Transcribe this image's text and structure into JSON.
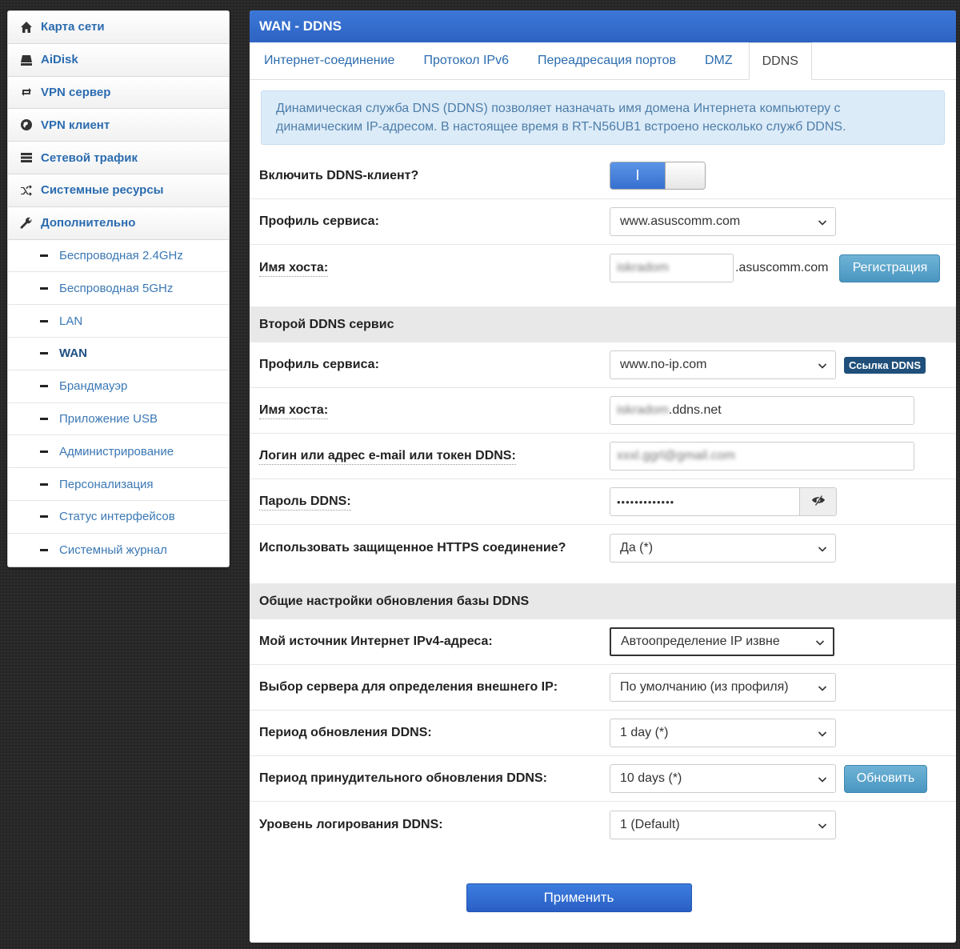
{
  "sidebar": {
    "items": [
      {
        "label": "Карта сети",
        "icon": "home-icon"
      },
      {
        "label": "AiDisk",
        "icon": "drive-icon"
      },
      {
        "label": "VPN сервер",
        "icon": "retweet-icon"
      },
      {
        "label": "VPN клиент",
        "icon": "globe-icon"
      },
      {
        "label": "Сетевой трафик",
        "icon": "tasks-icon"
      },
      {
        "label": "Системные ресурсы",
        "icon": "random-icon"
      },
      {
        "label": "Дополнительно",
        "icon": "wrench-icon"
      }
    ],
    "subitems": [
      "Беспроводная 2.4GHz",
      "Беспроводная 5GHz",
      "LAN",
      "WAN",
      "Брандмауэр",
      "Приложение USB",
      "Администрирование",
      "Персонализация",
      "Статус интерфейсов",
      "Системный журнал"
    ],
    "active_subitem": "WAN"
  },
  "panel": {
    "title": "WAN - DDNS",
    "tabs": [
      "Интернет-соединение",
      "Протокол IPv6",
      "Переадресация портов",
      "DMZ",
      "DDNS"
    ],
    "active_tab": "DDNS",
    "info": "Динамическая служба DNS (DDNS) позволяет назначать имя домена Интернета компьютеру с динамическим IP-адресом. В настоящее время в RT-N56UB1 встроено несколько служб DDNS."
  },
  "ddns": {
    "enable_label": "Включить DDNS-клиент?",
    "enable_on_text": "I",
    "profile_label": "Профиль сервиса:",
    "profile_value": "www.asuscomm.com",
    "host_label": "Имя хоста:",
    "host_value": "iskradom",
    "host_suffix": ".asuscomm.com",
    "register_button": "Регистрация"
  },
  "second": {
    "title": "Второй DDNS сервис",
    "profile_label": "Профиль сервиса:",
    "profile_value": "www.no-ip.com",
    "link_badge": "Ссылка DDNS",
    "host_label": "Имя хоста:",
    "host_prefix": "iskradom",
    "host_suffix": ".ddns.net",
    "login_label": "Логин или адрес e-mail или токен DDNS:",
    "login_value": "xxxl.ggrl@gmail.com",
    "password_label": "Пароль DDNS:",
    "password_value": "•••••••••••••",
    "https_label": "Использовать защищенное HTTPS соединение?",
    "https_value": "Да (*)"
  },
  "common": {
    "title": "Общие настройки обновления базы DDNS",
    "source_label": "Мой источник Интернет IPv4-адреса:",
    "source_value": "Автоопределение IP извне",
    "server_label": "Выбор сервера для определения внешнего IP:",
    "server_value": "По умолчанию (из профиля)",
    "period_label": "Период обновления DDNS:",
    "period_value": "1 day (*)",
    "force_label": "Период принудительного обновления DDNS:",
    "force_value": "10 days (*)",
    "update_button": "Обновить",
    "log_label": "Уровень логирования DDNS:",
    "log_value": "1 (Default)"
  },
  "apply_button": "Применить",
  "colors": {
    "header_blue": "#2e63c2",
    "link_blue": "#2b6cb0",
    "info_bg": "#dcebf8",
    "badge_bg": "#1f4f7a"
  }
}
